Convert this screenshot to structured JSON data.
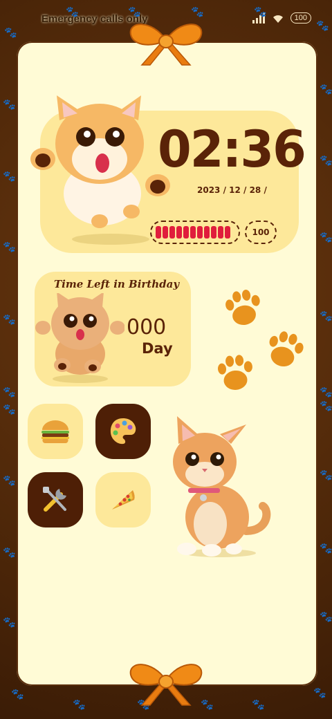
{
  "status_bar": {
    "carrier_text": "Emergency calls only",
    "battery_level": "100"
  },
  "clock": {
    "time": "02:36",
    "date": "2023 / 12 / 28 /",
    "battery_percent": "100",
    "battery_fill_fraction": 1.0
  },
  "birthday": {
    "title": "Time Left in Birthday",
    "count": "000",
    "unit": "Day"
  },
  "apps": [
    {
      "icon": "burger-icon",
      "style": "light"
    },
    {
      "icon": "palette-icon",
      "style": "dark"
    },
    {
      "icon": "tools-icon",
      "style": "dark"
    },
    {
      "icon": "pizza-icon",
      "style": "light"
    }
  ],
  "colors": {
    "frame": "#4a2508",
    "panel": "#fffbd6",
    "card": "#fde89a",
    "text_brown": "#5a2308",
    "battery_red": "#e01d3c",
    "paw_orange": "#f2a330"
  }
}
